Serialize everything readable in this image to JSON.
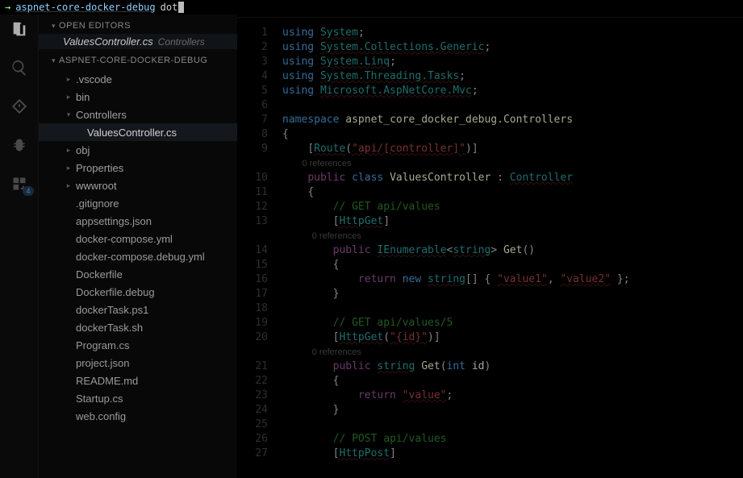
{
  "terminal": {
    "arrow": "→",
    "cwd": "aspnet-core-docker-debug",
    "input": "dot"
  },
  "activity": {
    "badge": "4"
  },
  "sidebar": {
    "openEditorsHeader": "OPEN EDITORS",
    "openEditor": {
      "file": "ValuesController.cs",
      "dir": "Controllers"
    },
    "projectHeader": "ASPNET-CORE-DOCKER-DEBUG",
    "tree": [
      {
        "label": ".vscode",
        "kind": "folder",
        "depth": 1,
        "selected": false
      },
      {
        "label": "bin",
        "kind": "folder",
        "depth": 1,
        "selected": false
      },
      {
        "label": "Controllers",
        "kind": "folder",
        "depth": 1,
        "open": true,
        "selected": false
      },
      {
        "label": "ValuesController.cs",
        "kind": "file",
        "depth": 2,
        "selected": true
      },
      {
        "label": "obj",
        "kind": "folder",
        "depth": 1,
        "selected": false
      },
      {
        "label": "Properties",
        "kind": "folder",
        "depth": 1,
        "selected": false
      },
      {
        "label": "wwwroot",
        "kind": "folder",
        "depth": 1,
        "selected": false
      },
      {
        "label": ".gitignore",
        "kind": "file",
        "depth": 1,
        "selected": false
      },
      {
        "label": "appsettings.json",
        "kind": "file",
        "depth": 1,
        "selected": false
      },
      {
        "label": "docker-compose.yml",
        "kind": "file",
        "depth": 1,
        "selected": false
      },
      {
        "label": "docker-compose.debug.yml",
        "kind": "file",
        "depth": 1,
        "selected": false
      },
      {
        "label": "Dockerfile",
        "kind": "file",
        "depth": 1,
        "selected": false
      },
      {
        "label": "Dockerfile.debug",
        "kind": "file",
        "depth": 1,
        "selected": false
      },
      {
        "label": "dockerTask.ps1",
        "kind": "file",
        "depth": 1,
        "selected": false
      },
      {
        "label": "dockerTask.sh",
        "kind": "file",
        "depth": 1,
        "selected": false
      },
      {
        "label": "Program.cs",
        "kind": "file",
        "depth": 1,
        "selected": false
      },
      {
        "label": "project.json",
        "kind": "file",
        "depth": 1,
        "selected": false
      },
      {
        "label": "README.md",
        "kind": "file",
        "depth": 1,
        "selected": false
      },
      {
        "label": "Startup.cs",
        "kind": "file",
        "depth": 1,
        "selected": false
      },
      {
        "label": "web.config",
        "kind": "file",
        "depth": 1,
        "selected": false
      }
    ]
  },
  "editor": {
    "tabLabel": "ValuesController.cs",
    "codelens": "0 references",
    "lines": [
      {
        "n": 1,
        "seg": [
          [
            "k",
            "using "
          ],
          [
            "t",
            "System"
          ],
          [
            "pn",
            ";"
          ]
        ]
      },
      {
        "n": 2,
        "seg": [
          [
            "k",
            "using "
          ],
          [
            "t",
            "System.Collections.Generic"
          ],
          [
            "pn",
            ";"
          ]
        ]
      },
      {
        "n": 3,
        "seg": [
          [
            "k",
            "using "
          ],
          [
            "t",
            "System.Linq"
          ],
          [
            "pn",
            ";"
          ]
        ]
      },
      {
        "n": 4,
        "seg": [
          [
            "k",
            "using "
          ],
          [
            "t",
            "System.Threading.Tasks"
          ],
          [
            "pn",
            ";"
          ]
        ]
      },
      {
        "n": 5,
        "seg": [
          [
            "k",
            "using "
          ],
          [
            "t",
            "Microsoft.AspNetCore.Mvc"
          ],
          [
            "pn",
            ";"
          ]
        ]
      },
      {
        "n": 6,
        "seg": []
      },
      {
        "n": 7,
        "seg": [
          [
            "k",
            "namespace "
          ],
          [
            "id",
            "aspnet_core_docker_debug.Controllers"
          ]
        ]
      },
      {
        "n": 8,
        "seg": [
          [
            "pn",
            "{"
          ]
        ]
      },
      {
        "n": 9,
        "indent": 1,
        "seg": [
          [
            "pn",
            "["
          ],
          [
            "attr",
            "Route"
          ],
          [
            "pn",
            "("
          ],
          [
            "s",
            "\"api/[controller]\""
          ],
          [
            "pn",
            ")]"
          ]
        ]
      },
      {
        "codelens": true,
        "indent": 1
      },
      {
        "n": 10,
        "indent": 1,
        "seg": [
          [
            "kp",
            "public "
          ],
          [
            "k",
            "class "
          ],
          [
            "id",
            "ValuesController"
          ],
          [
            "pn",
            " : "
          ],
          [
            "t",
            "Controller"
          ]
        ]
      },
      {
        "n": 11,
        "indent": 1,
        "seg": [
          [
            "pn",
            "{"
          ]
        ]
      },
      {
        "n": 12,
        "indent": 2,
        "seg": [
          [
            "c",
            "// GET api/values"
          ]
        ]
      },
      {
        "n": 13,
        "indent": 2,
        "seg": [
          [
            "pn",
            "["
          ],
          [
            "attr",
            "HttpGet"
          ],
          [
            "pn",
            "]"
          ]
        ]
      },
      {
        "codelens": true,
        "indent": 2
      },
      {
        "n": 14,
        "indent": 2,
        "seg": [
          [
            "kp",
            "public "
          ],
          [
            "t",
            "IEnumerable"
          ],
          [
            "pn",
            "<"
          ],
          [
            "t",
            "string"
          ],
          [
            "pn",
            "> "
          ],
          [
            "id",
            "Get"
          ],
          [
            "pn",
            "()"
          ]
        ]
      },
      {
        "n": 15,
        "indent": 2,
        "seg": [
          [
            "pn",
            "{"
          ]
        ]
      },
      {
        "n": 16,
        "indent": 3,
        "seg": [
          [
            "kp",
            "return "
          ],
          [
            "k",
            "new "
          ],
          [
            "t",
            "string"
          ],
          [
            "pn",
            "[] { "
          ],
          [
            "s",
            "\"value1\""
          ],
          [
            "pn",
            ", "
          ],
          [
            "s",
            "\"value2\""
          ],
          [
            "pn",
            " };"
          ]
        ]
      },
      {
        "n": 17,
        "indent": 2,
        "seg": [
          [
            "pn",
            "}"
          ]
        ]
      },
      {
        "n": 18,
        "indent": 0,
        "seg": []
      },
      {
        "n": 19,
        "indent": 2,
        "seg": [
          [
            "c",
            "// GET api/values/5"
          ]
        ]
      },
      {
        "n": 20,
        "indent": 2,
        "seg": [
          [
            "pn",
            "["
          ],
          [
            "attr",
            "HttpGet"
          ],
          [
            "pn",
            "("
          ],
          [
            "s",
            "\"{id}\""
          ],
          [
            "pn",
            ")]"
          ]
        ]
      },
      {
        "codelens": true,
        "indent": 2
      },
      {
        "n": 21,
        "indent": 2,
        "seg": [
          [
            "kp",
            "public "
          ],
          [
            "t",
            "string"
          ],
          [
            "pn",
            " "
          ],
          [
            "id",
            "Get"
          ],
          [
            "pn",
            "("
          ],
          [
            "k",
            "int "
          ],
          [
            "id",
            "id"
          ],
          [
            "pn",
            ")"
          ]
        ]
      },
      {
        "n": 22,
        "indent": 2,
        "seg": [
          [
            "pn",
            "{"
          ]
        ]
      },
      {
        "n": 23,
        "indent": 3,
        "seg": [
          [
            "kp",
            "return "
          ],
          [
            "s",
            "\"value\""
          ],
          [
            "pn",
            ";"
          ]
        ]
      },
      {
        "n": 24,
        "indent": 2,
        "seg": [
          [
            "pn",
            "}"
          ]
        ]
      },
      {
        "n": 25,
        "indent": 0,
        "seg": []
      },
      {
        "n": 26,
        "indent": 2,
        "seg": [
          [
            "c",
            "// POST api/values"
          ]
        ]
      },
      {
        "n": 27,
        "indent": 2,
        "seg": [
          [
            "pn",
            "["
          ],
          [
            "attr",
            "HttpPost"
          ],
          [
            "pn",
            "]"
          ]
        ]
      }
    ]
  }
}
